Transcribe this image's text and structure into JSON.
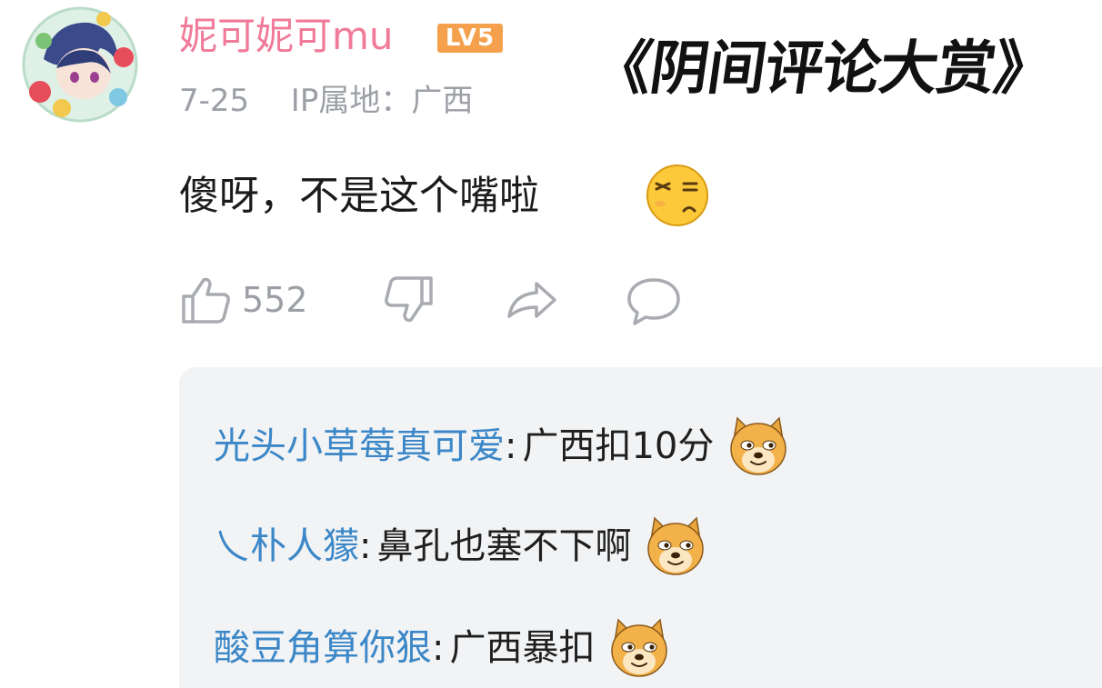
{
  "comment": {
    "username": "妮可妮可mu",
    "level_badge": "LV5",
    "date": "7-25",
    "ip_location": "IP属地：广西",
    "text": "傻呀，不是这个嘴啦",
    "emoji": "pouting-face-emoji"
  },
  "overlay": {
    "title": "《阴间评论大赏》"
  },
  "actions": {
    "like_count": "552",
    "icons": [
      "thumb-up-icon",
      "thumb-down-icon",
      "share-icon",
      "comment-icon"
    ]
  },
  "replies": [
    {
      "name": "光头小草莓真可爱",
      "sep": ":",
      "text": "广西扣10分",
      "emoji": "doge-emoji"
    },
    {
      "name": "乀朴人獴",
      "sep": ":",
      "text": "鼻孔也塞不下啊",
      "emoji": "doge-emoji"
    },
    {
      "name": "酸豆角算你狠",
      "sep": ":",
      "text": "广西暴扣",
      "emoji": "doge-emoji"
    }
  ],
  "colors": {
    "username": "#f07a97",
    "level_badge": "#f4a04c",
    "meta_gray": "#9ca0a6",
    "reply_name_blue": "#3b87c7",
    "replies_bg": "#f2f3f5"
  }
}
